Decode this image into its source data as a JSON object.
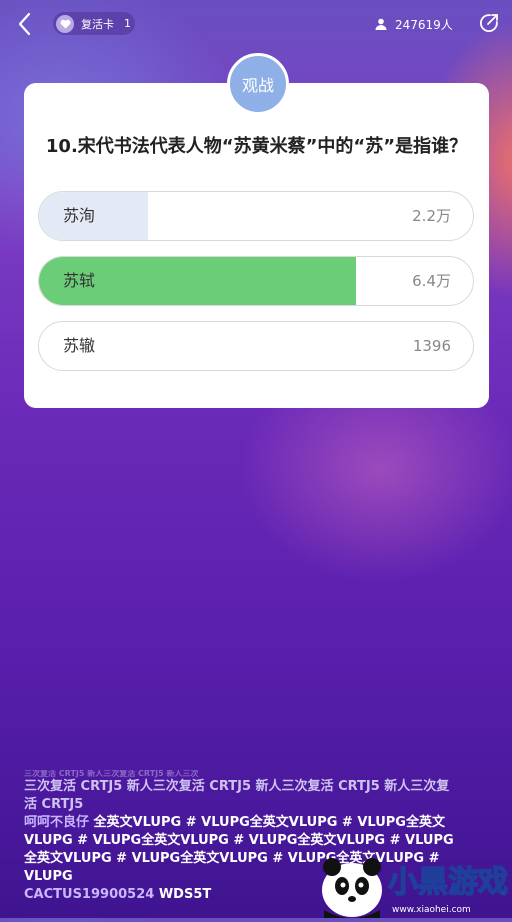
{
  "topbar": {
    "revive_label": "复活卡",
    "revive_count": "1",
    "viewer_count": "247619人"
  },
  "card": {
    "badge": "观战",
    "question": "10.宋代书法代表人物“苏黄米蔡”中的“苏”是指谁？",
    "options": [
      {
        "label": "苏洵",
        "value": "2.2万",
        "fraction": 0.25,
        "color": "#e4eaf5"
      },
      {
        "label": "苏轼",
        "value": "6.4万",
        "fraction": 0.73,
        "color": "#6ccd78"
      },
      {
        "label": "苏辙",
        "value": "1396",
        "fraction": 0.0,
        "color": "#ffffff"
      }
    ]
  },
  "chat": {
    "faded_line": "三次复活 CRTJ5 新人三次复活 CRTJ5 新人三次",
    "system_text": "三次复活 CRTJ5 新人三次复活 CRTJ5 新人三次复活 CRTJ5 新人三次复活 CRTJ5",
    "user_name": "呵呵不良仔",
    "user_msg": "全英文VLUPG # VLUPG全英文VLUPG # VLUPG全英文VLUPG # VLUPG全英文VLUPG # VLUPG全英文VLUPG # VLUPG全英文VLUPG # VLUPG全英文VLUPG # VLUPG全英文VLUPG # VLUPG",
    "user2_name": "CACTUS19900524",
    "user2_msg": "WDS5T"
  },
  "logo": {
    "text": "小黑游戏",
    "url": "www.xiaohei.com"
  },
  "colors": {
    "correct": "#6ccd78",
    "badge": "#8fb0e6"
  }
}
